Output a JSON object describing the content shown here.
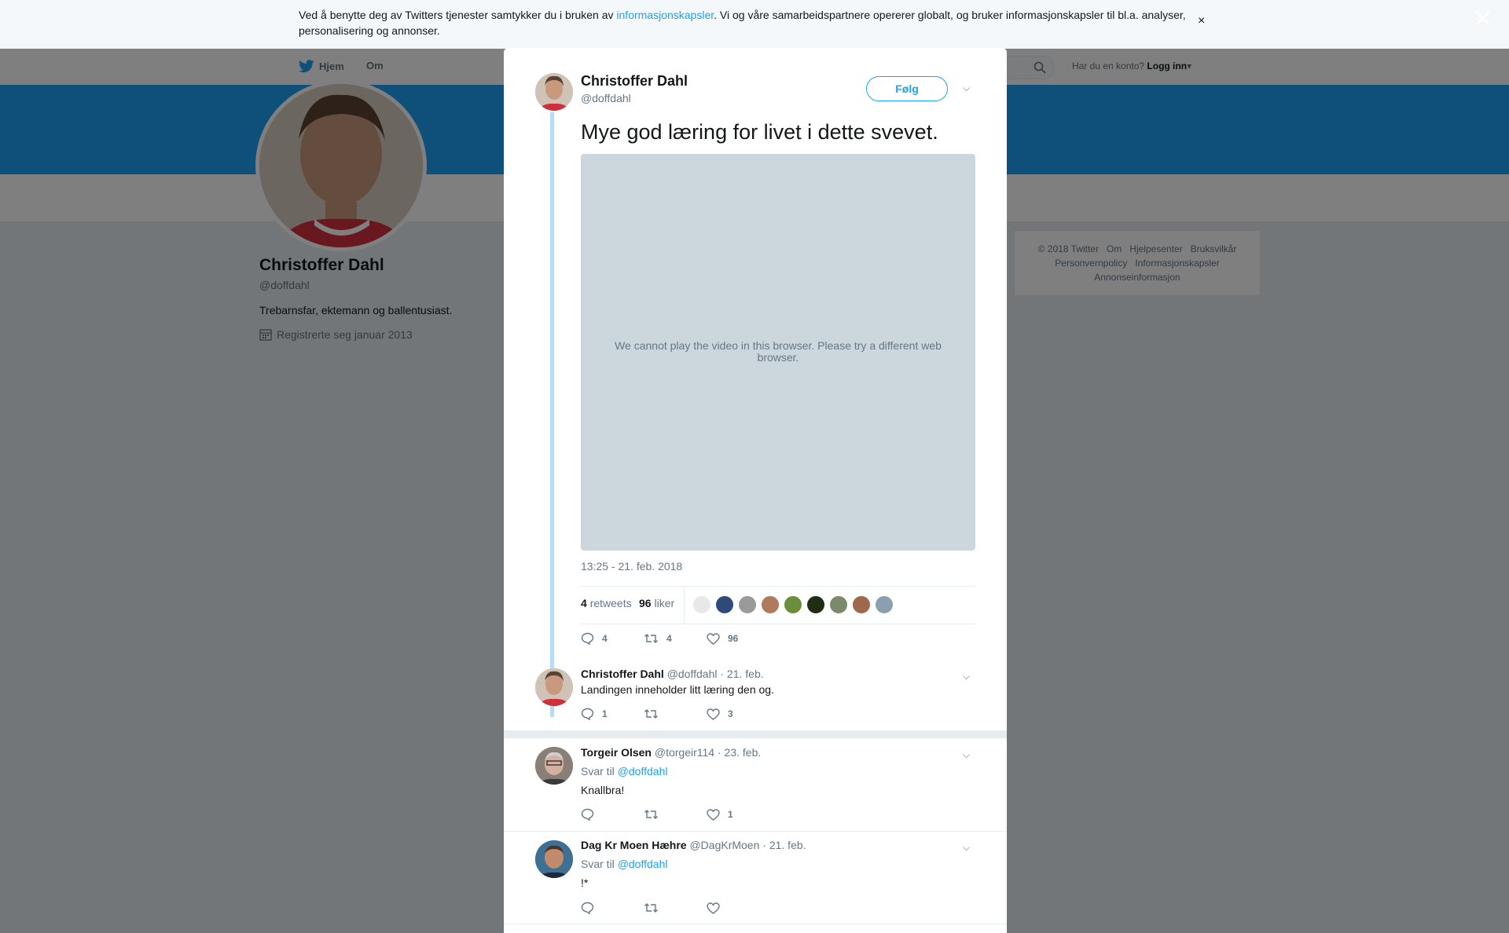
{
  "cookie": {
    "text_before": "Ved å benytte deg av Twitters tjenester samtykker du i bruken av ",
    "link": "informasjonskapsler",
    "text_after": ". Vi og våre samarbeidspartnere opererer globalt, og bruker informasjonskapsler til bl.a. analyser, personalisering og annonser.",
    "close": "×"
  },
  "overlay_close": "✕",
  "nav": {
    "home": "Hjem",
    "about": "Om",
    "login_prompt": "Har du en konto?",
    "login": "Logg inn"
  },
  "profile": {
    "name": "Christoffer Dahl",
    "handle": "@doffdahl",
    "bio": "Trebarnsfar, ektemann og ballentusiast.",
    "joined": "Registrerte seg januar 2013"
  },
  "footer": [
    "© 2018 Twitter",
    "Om",
    "Hjelpesenter",
    "Bruksvilkår",
    "Personvernpolicy",
    "Informasjonskapsler",
    "Annonseinformasjon"
  ],
  "tweet": {
    "name": "Christoffer Dahl",
    "handle": "@doffdahl",
    "follow": "Følg",
    "text": "Mye god læring for livet i dette svevet.",
    "video_message": "We cannot play the video in this browser. Please try a different web browser.",
    "timestamp": "13:25 - 21. feb. 2018",
    "retweets": "4",
    "retweets_label": "retweets",
    "likes": "96",
    "likes_label": "liker",
    "actions": {
      "replies": "4",
      "retweets": "4",
      "likes": "96"
    }
  },
  "replies": [
    {
      "name": "Christoffer Dahl",
      "handle": "@doffdahl",
      "date": "· 21. feb.",
      "reply_to_label": "",
      "reply_to": "",
      "text": "Landingen inneholder litt læring den og.",
      "replies": "1",
      "retweets": "",
      "likes": "3"
    },
    {
      "name": "Torgeir Olsen",
      "handle": "@torgeir114",
      "date": "· 23. feb.",
      "reply_to_label": "Svar til",
      "reply_to": "@doffdahl",
      "text": "Knallbra!",
      "replies": "",
      "retweets": "",
      "likes": "1"
    },
    {
      "name": "Dag Kr Moen Hæhre",
      "handle": "@DagKrMoen",
      "date": "· 21. feb.",
      "reply_to_label": "Svar til",
      "reply_to": "@doffdahl",
      "text": "!*",
      "replies": "",
      "retweets": "",
      "likes": ""
    }
  ],
  "colors": {
    "accent": "#1da1f2",
    "thread_line": "#b7dcf5",
    "video_bg": "#ccd6dd"
  }
}
